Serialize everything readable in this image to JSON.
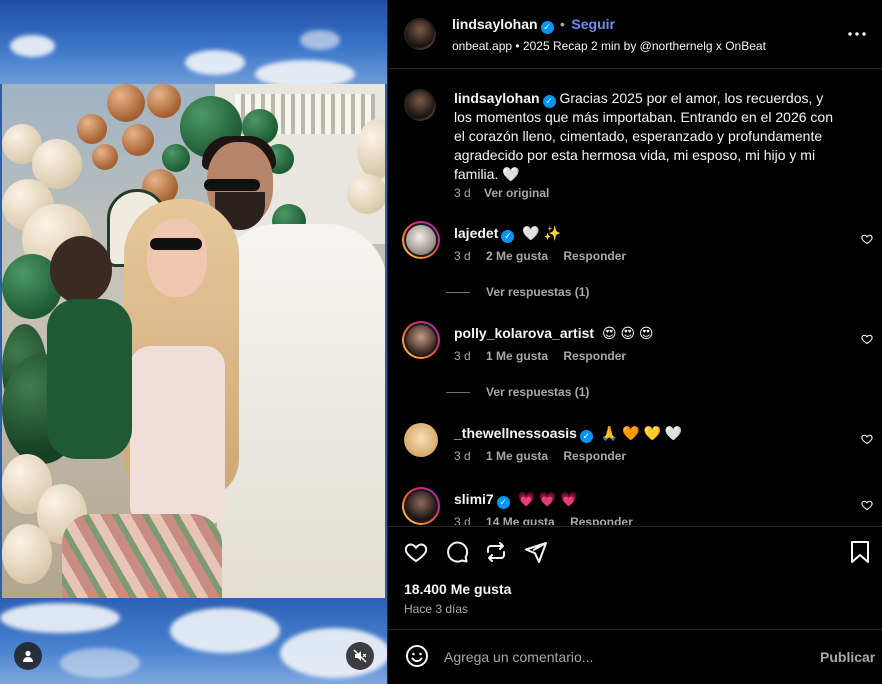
{
  "post": {
    "username": "lindsaylohan",
    "follow_label": "Seguir",
    "audio": "onbeat.app • 2025 Recap 2 min by @northernelg x OnBeat",
    "more_icon": "more-options-icon"
  },
  "caption": {
    "username": "lindsaylohan",
    "text": "Gracias 2025 por el amor, los recuerdos, y los momentos que más importaban. Entrando en el 2026 con el corazón lleno, cimentado, esperanzado y profundamente agradecido por esta hermosa vida, mi esposo, mi hijo y mi familia. 🤍",
    "time": "3 d",
    "see_original": "Ver original"
  },
  "comments": [
    {
      "username": "lajedet",
      "verified": true,
      "text": "🤍 ✨",
      "time": "3 d",
      "likes": "2 Me gusta",
      "reply": "Responder",
      "replies": "Ver respuestas (1)",
      "avatar_color": "#d9d2c8"
    },
    {
      "username": "polly_kolarova_artist",
      "verified": false,
      "text": "😍 😍 😍",
      "time": "3 d",
      "likes": "1 Me gusta",
      "reply": "Responder",
      "replies": "Ver respuestas (1)",
      "avatar_color": "#5a3b33"
    },
    {
      "username": "_thewellnessoasis",
      "verified": true,
      "text": "🙏 🧡 💛 🤍",
      "time": "3 d",
      "likes": "1 Me gusta",
      "reply": "Responder",
      "replies": "",
      "avatar_color": "#e2b57a"
    },
    {
      "username": "slimi7",
      "verified": true,
      "text": "💗 💗 💗",
      "time": "3 d",
      "likes": "14 Me gusta",
      "reply": "Responder",
      "replies": "",
      "avatar_color": "#4a3330"
    }
  ],
  "actions": {
    "likes": "18.400 Me gusta",
    "time": "Hace 3 días"
  },
  "composer": {
    "placeholder": "Agrega un comentario...",
    "publish": "Publicar"
  },
  "colors": {
    "background": "#000000",
    "link_blue": "#6d8ef6",
    "verified_blue": "#0095f6",
    "muted": "#a8a8a8"
  }
}
